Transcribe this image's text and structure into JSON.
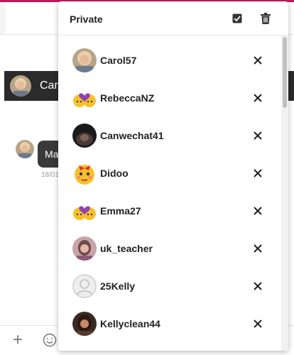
{
  "background": {
    "chat_header_name": "Car",
    "message_text": "Ma",
    "message_time": "18/01"
  },
  "panel": {
    "title": "Private",
    "header_icons": [
      "checkbox-icon",
      "trash-icon"
    ],
    "users": [
      {
        "name": "Carol57",
        "avatar": "photo-blonde-woman"
      },
      {
        "name": "RebeccaNZ",
        "avatar": "emoji-two-hearts-faces"
      },
      {
        "name": "Canwechat41",
        "avatar": "photo-dark"
      },
      {
        "name": "Didoo",
        "avatar": "emoji-face-with-bow"
      },
      {
        "name": "Emma27",
        "avatar": "emoji-two-hearts-faces"
      },
      {
        "name": "uk_teacher",
        "avatar": "photo-woman"
      },
      {
        "name": "25Kelly",
        "avatar": "default-user-silhouette"
      },
      {
        "name": "Kellyclean44",
        "avatar": "photo-woman-dark-hair"
      }
    ],
    "row_action_icon": "close-icon"
  },
  "colors": {
    "accent": "#c2185b",
    "header_dark": "#2b2b2b",
    "emoji_yellow": "#f7c02a",
    "heart_purple": "#8e44ad"
  }
}
